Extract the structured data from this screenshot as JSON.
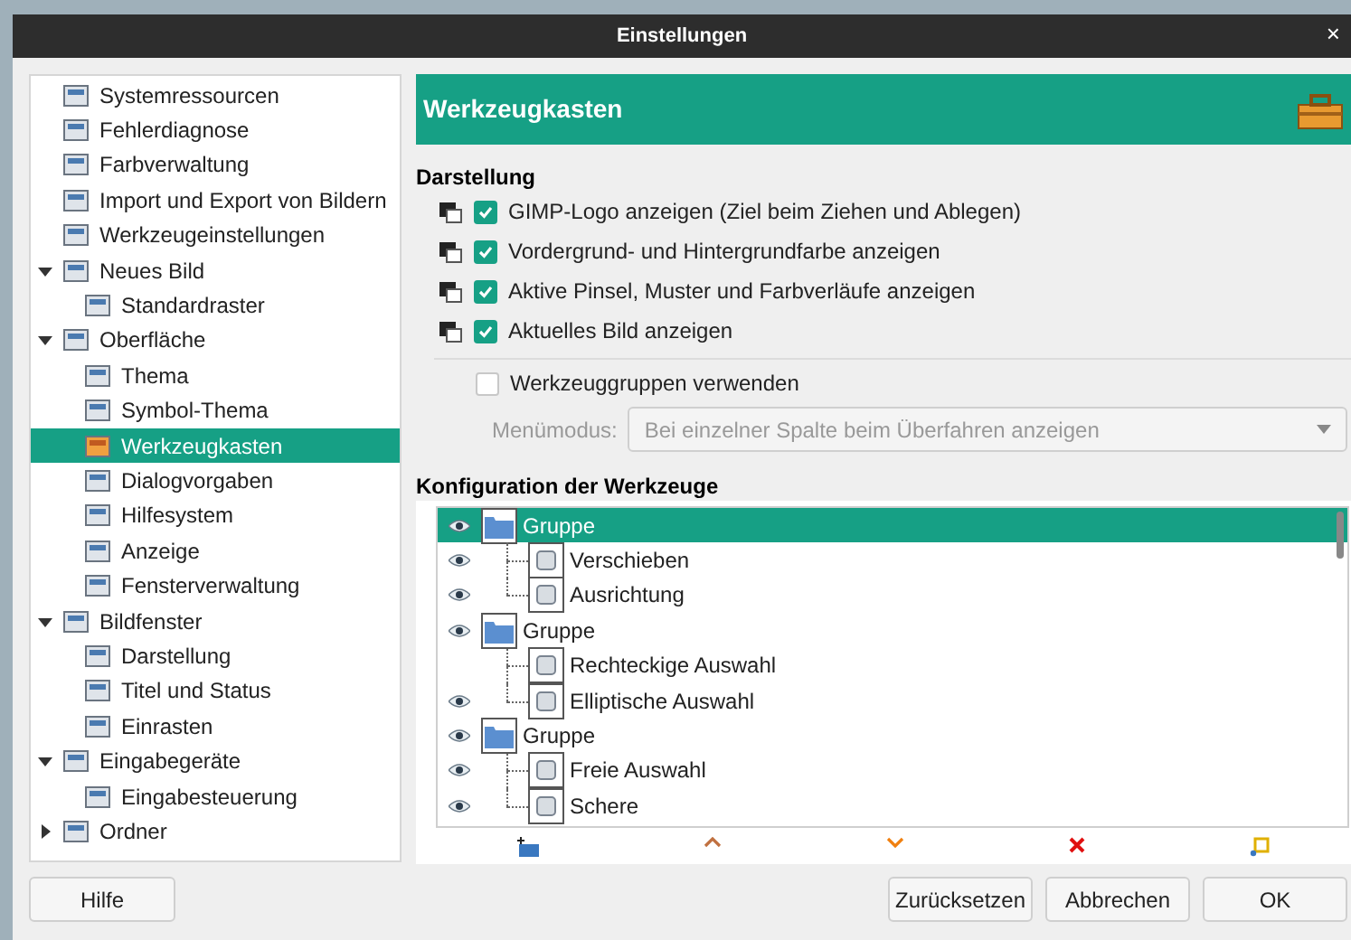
{
  "window": {
    "title": "Einstellungen",
    "close": "×"
  },
  "sidebar": {
    "items": [
      {
        "label": "Systemressourcen",
        "selected": false
      },
      {
        "label": "Fehlerdiagnose",
        "selected": false
      },
      {
        "label": "Farbverwaltung",
        "selected": false
      },
      {
        "label": "Import und Export von Bildern",
        "selected": false
      },
      {
        "label": "Werkzeugeinstellungen",
        "selected": false
      },
      {
        "label": "Neues Bild",
        "expanded": true,
        "selected": false,
        "children": [
          {
            "label": "Standardraster",
            "selected": false
          }
        ]
      },
      {
        "label": "Oberfläche",
        "expanded": true,
        "selected": false,
        "children": [
          {
            "label": "Thema",
            "selected": false
          },
          {
            "label": "Symbol-Thema",
            "selected": false
          },
          {
            "label": "Werkzeugkasten",
            "selected": true
          },
          {
            "label": "Dialogvorgaben",
            "selected": false
          },
          {
            "label": "Hilfesystem",
            "selected": false
          },
          {
            "label": "Anzeige",
            "selected": false
          },
          {
            "label": "Fensterverwaltung",
            "selected": false
          }
        ]
      },
      {
        "label": "Bildfenster",
        "expanded": true,
        "selected": false,
        "children": [
          {
            "label": "Darstellung",
            "selected": false
          },
          {
            "label": "Titel und Status",
            "selected": false
          },
          {
            "label": "Einrasten",
            "selected": false
          }
        ]
      },
      {
        "label": "Eingabegeräte",
        "expanded": true,
        "selected": false,
        "children": [
          {
            "label": "Eingabesteuerung",
            "selected": false
          }
        ]
      },
      {
        "label": "Ordner",
        "expanded": false,
        "selected": false
      }
    ]
  },
  "page": {
    "title": "Werkzeugkasten",
    "display": {
      "heading": "Darstellung",
      "options": [
        {
          "label": "GIMP-Logo anzeigen (Ziel beim Ziehen und Ablegen)",
          "checked": true
        },
        {
          "label": "Vordergrund- und Hintergrundfarbe anzeigen",
          "checked": true
        },
        {
          "label": "Aktive Pinsel, Muster und Farbverläufe anzeigen",
          "checked": true
        },
        {
          "label": "Aktuelles Bild anzeigen",
          "checked": true
        }
      ],
      "groups_option": {
        "label": "Werkzeuggruppen verwenden",
        "checked": false
      },
      "menu_mode": {
        "label": "Menümodus:",
        "value": "Bei einzelner Spalte beim Überfahren anzeigen",
        "disabled": true
      }
    },
    "tools": {
      "heading": "Konfiguration der Werkzeuge",
      "rows": [
        {
          "kind": "group",
          "label": "Gruppe",
          "visible": true,
          "selected": true,
          "children": [
            {
              "kind": "tool",
              "label": "Verschieben",
              "visible": true,
              "selected": false
            },
            {
              "kind": "tool",
              "label": "Ausrichtung",
              "visible": true,
              "selected": false
            }
          ]
        },
        {
          "kind": "group",
          "label": "Gruppe",
          "visible": true,
          "selected": false,
          "children": [
            {
              "kind": "tool",
              "label": "Rechteckige Auswahl",
              "visible": false,
              "selected": false
            },
            {
              "kind": "tool",
              "label": "Elliptische Auswahl",
              "visible": true,
              "selected": false
            }
          ]
        },
        {
          "kind": "group",
          "label": "Gruppe",
          "visible": true,
          "selected": false,
          "children": [
            {
              "kind": "tool",
              "label": "Freie Auswahl",
              "visible": true,
              "selected": false
            },
            {
              "kind": "tool",
              "label": "Schere",
              "visible": true,
              "selected": false
            }
          ]
        }
      ]
    }
  },
  "buttons": {
    "help": "Hilfe",
    "actions": [
      "Zurücksetzen",
      "Abbrechen",
      "OK"
    ]
  }
}
